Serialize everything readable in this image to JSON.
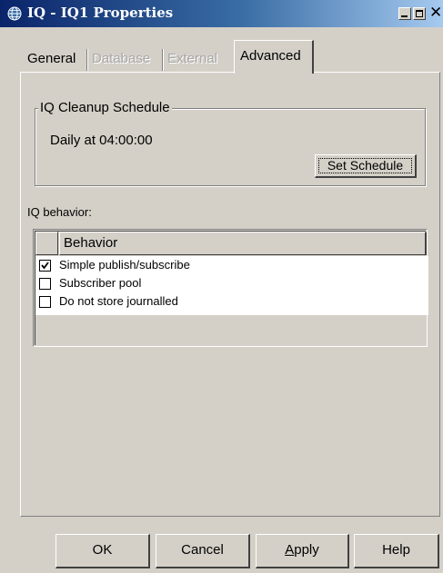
{
  "window": {
    "title": "IQ - IQ1 Properties",
    "close_glyph": "✕"
  },
  "tabs": [
    {
      "label": "General",
      "enabled": true,
      "selected": false
    },
    {
      "label": "Database",
      "enabled": false,
      "selected": false
    },
    {
      "label": "External",
      "enabled": false,
      "selected": false
    },
    {
      "label": "Advanced",
      "enabled": true,
      "selected": true
    }
  ],
  "cleanup": {
    "group_title": "IQ Cleanup Schedule",
    "schedule_text": "Daily at 04:00:00",
    "set_schedule_label": "Set Schedule"
  },
  "behavior": {
    "label": "IQ behavior:",
    "column_header": "Behavior",
    "rows": [
      {
        "label": "Simple publish/subscribe",
        "checked": true
      },
      {
        "label": "Subscriber pool",
        "checked": false
      },
      {
        "label": "Do not store journalled",
        "checked": false
      }
    ]
  },
  "buttons": {
    "ok": "OK",
    "cancel": "Cancel",
    "apply": "Apply",
    "help": "Help"
  },
  "colors": {
    "dialog_bg": "#d4d0c8",
    "titlebar_start": "#0a246a",
    "titlebar_end": "#a6caf0",
    "disabled_text": "#a8a8a8"
  },
  "icons": {
    "title": "globe-icon",
    "checkbox_checked": "checkmark-icon"
  }
}
